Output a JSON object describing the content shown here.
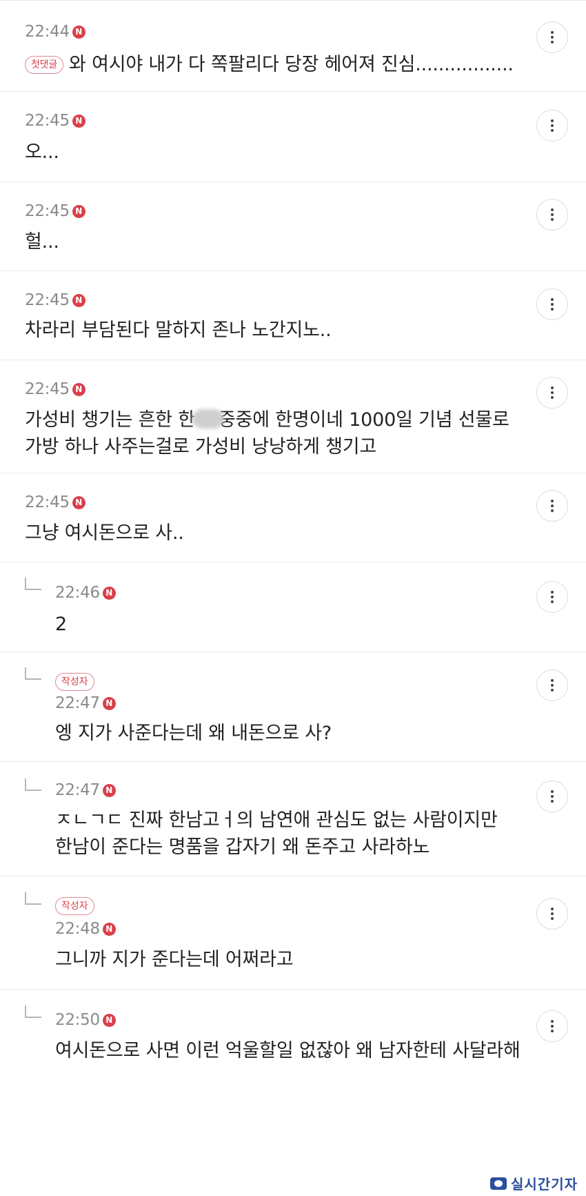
{
  "comments": [
    {
      "time": "22:44",
      "badge": "N",
      "first_label": "첫댓글",
      "lines": [
        "와 여시야 내가 다 쪽팔리다 당장 헤어져 진심................."
      ]
    },
    {
      "time": "22:45",
      "badge": "N",
      "lines": [
        "오..."
      ]
    },
    {
      "time": "22:45",
      "badge": "N",
      "lines": [
        "헐..."
      ]
    },
    {
      "time": "22:45",
      "badge": "N",
      "lines": [
        "차라리 부담된다 말하지 존나 노간지노.."
      ]
    },
    {
      "time": "22:45",
      "badge": "N",
      "lines": [
        "가성비 챙기는 흔한 한남중중에 한명이네 1000일 기념 선물로",
        "가방 하나 사주는걸로 가성비 낭낭하게 챙기고"
      ],
      "line1_pre": "가성비 챙기는 흔한 한",
      "line1_post": "중중에 한명이네 1000일 기념 선물로"
    },
    {
      "time": "22:45",
      "badge": "N",
      "lines": [
        "그냥 여시돈으로 사.."
      ]
    },
    {
      "time": "22:46",
      "badge": "N",
      "lines": [
        "2"
      ]
    },
    {
      "time": "22:47",
      "badge": "N",
      "author_label": "작성자",
      "lines": [
        "엥 지가 사준다는데 왜 내돈으로 사?"
      ]
    },
    {
      "time": "22:47",
      "badge": "N",
      "lines": [
        "ㅈㄴㄱㄷ 진짜 한남고ㅓ의 남연애 관심도 없는 사람이지만",
        "한남이 준다는 명품을 갑자기 왜 돈주고 사라하노"
      ]
    },
    {
      "time": "22:48",
      "badge": "N",
      "author_label": "작성자",
      "lines": [
        "그니까 지가 준다는데 어쩌라고"
      ]
    },
    {
      "time": "22:50",
      "badge": "N",
      "lines": [
        "여시돈으로 사면 이런 억울할일 없잖아 왜 남자한테 사달라해"
      ]
    }
  ],
  "watermark": "실시간기자"
}
